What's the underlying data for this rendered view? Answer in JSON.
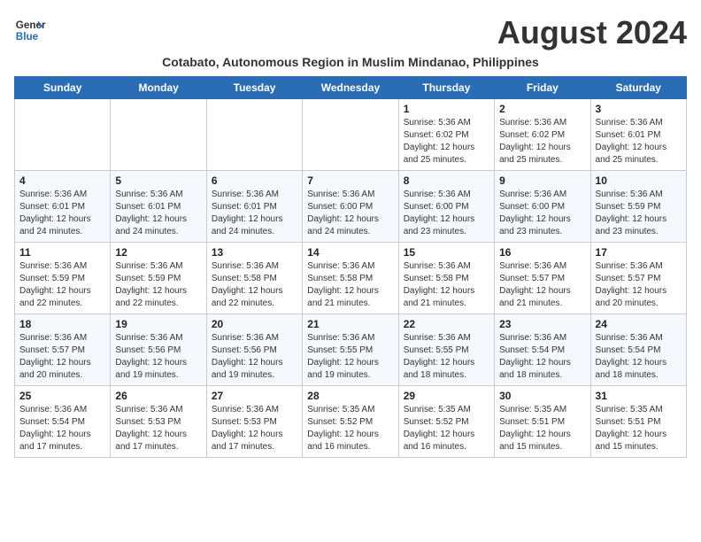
{
  "header": {
    "logo_line1": "General",
    "logo_line2": "Blue",
    "month_title": "August 2024",
    "subtitle": "Cotabato, Autonomous Region in Muslim Mindanao, Philippines"
  },
  "days_of_week": [
    "Sunday",
    "Monday",
    "Tuesday",
    "Wednesday",
    "Thursday",
    "Friday",
    "Saturday"
  ],
  "weeks": [
    [
      {
        "day": "",
        "info": ""
      },
      {
        "day": "",
        "info": ""
      },
      {
        "day": "",
        "info": ""
      },
      {
        "day": "",
        "info": ""
      },
      {
        "day": "1",
        "info": "Sunrise: 5:36 AM\nSunset: 6:02 PM\nDaylight: 12 hours and 25 minutes."
      },
      {
        "day": "2",
        "info": "Sunrise: 5:36 AM\nSunset: 6:02 PM\nDaylight: 12 hours and 25 minutes."
      },
      {
        "day": "3",
        "info": "Sunrise: 5:36 AM\nSunset: 6:01 PM\nDaylight: 12 hours and 25 minutes."
      }
    ],
    [
      {
        "day": "4",
        "info": "Sunrise: 5:36 AM\nSunset: 6:01 PM\nDaylight: 12 hours and 24 minutes."
      },
      {
        "day": "5",
        "info": "Sunrise: 5:36 AM\nSunset: 6:01 PM\nDaylight: 12 hours and 24 minutes."
      },
      {
        "day": "6",
        "info": "Sunrise: 5:36 AM\nSunset: 6:01 PM\nDaylight: 12 hours and 24 minutes."
      },
      {
        "day": "7",
        "info": "Sunrise: 5:36 AM\nSunset: 6:00 PM\nDaylight: 12 hours and 24 minutes."
      },
      {
        "day": "8",
        "info": "Sunrise: 5:36 AM\nSunset: 6:00 PM\nDaylight: 12 hours and 23 minutes."
      },
      {
        "day": "9",
        "info": "Sunrise: 5:36 AM\nSunset: 6:00 PM\nDaylight: 12 hours and 23 minutes."
      },
      {
        "day": "10",
        "info": "Sunrise: 5:36 AM\nSunset: 5:59 PM\nDaylight: 12 hours and 23 minutes."
      }
    ],
    [
      {
        "day": "11",
        "info": "Sunrise: 5:36 AM\nSunset: 5:59 PM\nDaylight: 12 hours and 22 minutes."
      },
      {
        "day": "12",
        "info": "Sunrise: 5:36 AM\nSunset: 5:59 PM\nDaylight: 12 hours and 22 minutes."
      },
      {
        "day": "13",
        "info": "Sunrise: 5:36 AM\nSunset: 5:58 PM\nDaylight: 12 hours and 22 minutes."
      },
      {
        "day": "14",
        "info": "Sunrise: 5:36 AM\nSunset: 5:58 PM\nDaylight: 12 hours and 21 minutes."
      },
      {
        "day": "15",
        "info": "Sunrise: 5:36 AM\nSunset: 5:58 PM\nDaylight: 12 hours and 21 minutes."
      },
      {
        "day": "16",
        "info": "Sunrise: 5:36 AM\nSunset: 5:57 PM\nDaylight: 12 hours and 21 minutes."
      },
      {
        "day": "17",
        "info": "Sunrise: 5:36 AM\nSunset: 5:57 PM\nDaylight: 12 hours and 20 minutes."
      }
    ],
    [
      {
        "day": "18",
        "info": "Sunrise: 5:36 AM\nSunset: 5:57 PM\nDaylight: 12 hours and 20 minutes."
      },
      {
        "day": "19",
        "info": "Sunrise: 5:36 AM\nSunset: 5:56 PM\nDaylight: 12 hours and 19 minutes."
      },
      {
        "day": "20",
        "info": "Sunrise: 5:36 AM\nSunset: 5:56 PM\nDaylight: 12 hours and 19 minutes."
      },
      {
        "day": "21",
        "info": "Sunrise: 5:36 AM\nSunset: 5:55 PM\nDaylight: 12 hours and 19 minutes."
      },
      {
        "day": "22",
        "info": "Sunrise: 5:36 AM\nSunset: 5:55 PM\nDaylight: 12 hours and 18 minutes."
      },
      {
        "day": "23",
        "info": "Sunrise: 5:36 AM\nSunset: 5:54 PM\nDaylight: 12 hours and 18 minutes."
      },
      {
        "day": "24",
        "info": "Sunrise: 5:36 AM\nSunset: 5:54 PM\nDaylight: 12 hours and 18 minutes."
      }
    ],
    [
      {
        "day": "25",
        "info": "Sunrise: 5:36 AM\nSunset: 5:54 PM\nDaylight: 12 hours and 17 minutes."
      },
      {
        "day": "26",
        "info": "Sunrise: 5:36 AM\nSunset: 5:53 PM\nDaylight: 12 hours and 17 minutes."
      },
      {
        "day": "27",
        "info": "Sunrise: 5:36 AM\nSunset: 5:53 PM\nDaylight: 12 hours and 17 minutes."
      },
      {
        "day": "28",
        "info": "Sunrise: 5:35 AM\nSunset: 5:52 PM\nDaylight: 12 hours and 16 minutes."
      },
      {
        "day": "29",
        "info": "Sunrise: 5:35 AM\nSunset: 5:52 PM\nDaylight: 12 hours and 16 minutes."
      },
      {
        "day": "30",
        "info": "Sunrise: 5:35 AM\nSunset: 5:51 PM\nDaylight: 12 hours and 15 minutes."
      },
      {
        "day": "31",
        "info": "Sunrise: 5:35 AM\nSunset: 5:51 PM\nDaylight: 12 hours and 15 minutes."
      }
    ]
  ]
}
